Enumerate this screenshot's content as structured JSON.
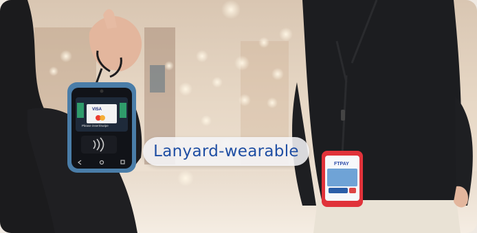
{
  "overlay": {
    "caption": "Lanyard-wearable"
  },
  "left_device": {
    "card_brand": "VISA",
    "prompt": "Please insert/swipe"
  },
  "right_device": {
    "brand": "FTPAY"
  },
  "colors": {
    "caption_text": "#1f4ea3",
    "caption_bg": "#f4f4f6",
    "left_device_shell": "#4a7da8",
    "right_device_shell": "#e0323a"
  },
  "icons": [
    "contactless-icon",
    "back-icon",
    "home-icon",
    "menu-icon"
  ]
}
